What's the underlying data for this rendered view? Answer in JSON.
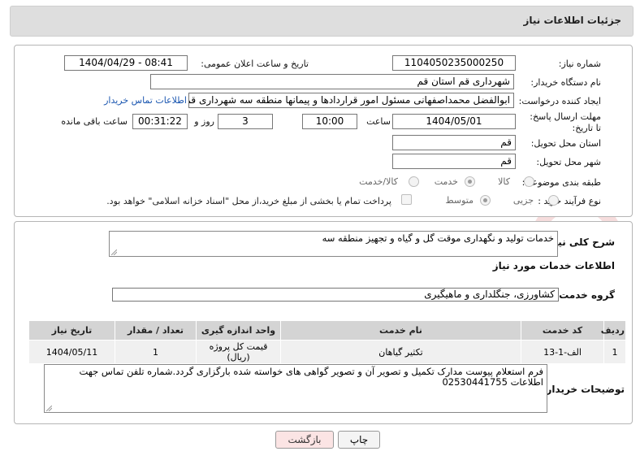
{
  "header": {
    "title": "جزئیات اطلاعات نیاز"
  },
  "form": {
    "need_number_label": "شماره نیاز:",
    "need_number": "1104050235000250",
    "announce_label": "تاریخ و ساعت اعلان عمومی:",
    "announce_value": "1404/04/29 - 08:41",
    "buyer_org_label": "نام دستگاه خریدار:",
    "buyer_org": "شهرداری قم استان قم",
    "creator_label": "ایجاد کننده درخواست:",
    "creator": "ابوالفضل محمداصفهانی مسئول امور قراردادها و پیمانها منطقه سه شهرداری قم",
    "contact_link": "اطلاعات تماس خریدار",
    "deadline_label": "مهلت ارسال پاسخ: تا تاریخ:",
    "deadline_date": "1404/05/01",
    "time_label": "ساعت",
    "deadline_time": "10:00",
    "days_value": "3",
    "days_label": "روز و",
    "remaining_time": "00:31:22",
    "remaining_label": "ساعت باقی مانده",
    "province_label": "استان محل تحویل:",
    "province": "قم",
    "city_label": "شهر محل تحویل:",
    "city": "قم",
    "category_label": "طبقه بندی موضوعی:",
    "category_options": [
      "کالا",
      "خدمت",
      "کالا/خدمت"
    ],
    "category_selected": "خدمت",
    "process_label": "نوع فرآیند خرید :",
    "process_options": [
      "جزیی",
      "متوسط"
    ],
    "process_selected": "متوسط",
    "payment_note": "پرداخت تمام یا بخشی از مبلغ خرید،از محل \"اسناد خزانه اسلامی\" خواهد بود."
  },
  "summary": {
    "label": "شرح کلی نیاز:",
    "text": "خدمات تولید و نگهداری موقت گل و گیاه و تجهیز منطقه سه",
    "services_heading": "اطلاعات خدمات مورد نیاز",
    "group_label": "گروه خدمت:",
    "group_value": "کشاورزی، جنگلداری و ماهیگیری"
  },
  "table": {
    "headers": [
      "ردیف",
      "کد خدمت",
      "نام خدمت",
      "واحد اندازه گیری",
      "تعداد / مقدار",
      "تاریخ نیاز"
    ],
    "rows": [
      [
        "1",
        "الف-1-13",
        "تکثیر گیاهان",
        "قیمت کل پروژه (ریال)",
        "1",
        "1404/05/11"
      ]
    ]
  },
  "notes": {
    "label": "توضیحات خریدار:",
    "text": "فرم استعلام پیوست مدارک تکمیل و تصویر آن و تصویر گواهی های خواسته شده بارگزاری گردد.شماره تلفن تماس جهت اطلاعات 02530441755"
  },
  "buttons": {
    "print": "چاپ",
    "back": "بازگشت"
  },
  "watermark": {
    "text": "AriaTender.net"
  },
  "colors": {
    "link": "#1a56b0",
    "back_button": "#fbe4e4",
    "print_button": "#f4f4f4",
    "header_bg": "#dedede"
  }
}
